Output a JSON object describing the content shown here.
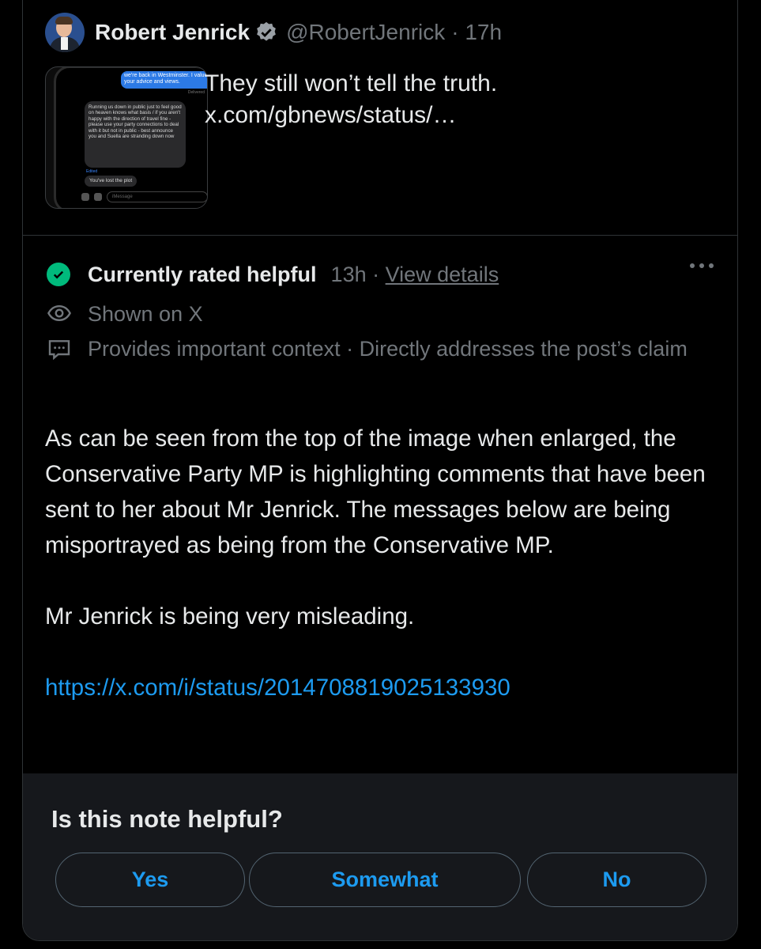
{
  "tweet": {
    "author_name": "Robert Jenrick",
    "author_handle": "@RobertJenrick",
    "time": "· 17h",
    "text_line1": "They still won’t tell the truth.",
    "text_line2": "x.com/gbnews/status/…",
    "media_text": {
      "blue_bubble": "we're back in Westminster. I value your advice and views.",
      "delivered": "Delivered",
      "grey_bubble": "Running us down in public just to feel good on heaven knows what basis / if you aren't happy with the direction of travel fine - please use your party connections to deal with it but not in public - best announce you and Suella are stranding down now",
      "edited": "Edited",
      "reply": "You've lost the plot",
      "input_placeholder": "iMessage"
    }
  },
  "note": {
    "status": "Currently rated helpful",
    "time": "13h ·",
    "view_details": "View details",
    "shown_on": "Shown on X",
    "reasons": "Provides important context · Directly addresses the post’s claim",
    "paragraph1": "As can be seen from the top of the image when enlarged, the Conservative Party MP is highlighting comments that have been sent to her about Mr Jenrick. The messages below are being misportrayed as being from the Conservative MP.",
    "paragraph2": "Mr Jenrick is being very misleading.",
    "link": "https://x.com/i/status/2014708819025133930"
  },
  "rating": {
    "question": "Is this note helpful?",
    "yes": "Yes",
    "somewhat": "Somewhat",
    "no": "No"
  },
  "colors": {
    "background": "#000000",
    "text": "#e7e9ea",
    "muted": "#71767b",
    "accent_blue": "#1d9bf0",
    "helpful_green": "#00ba7c",
    "footer_bg": "#16181c"
  },
  "icons": [
    "verified-badge-icon",
    "check-circle-icon",
    "more-options-icon",
    "eye-icon",
    "comment-box-icon"
  ]
}
